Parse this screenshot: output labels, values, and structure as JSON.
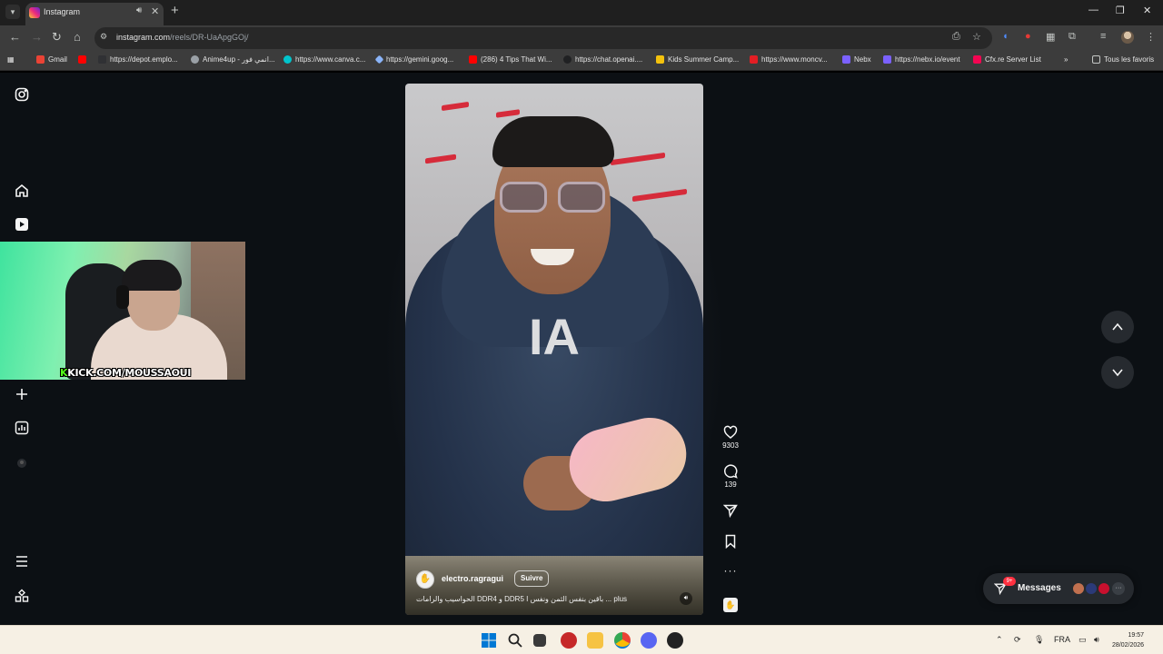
{
  "browser": {
    "tab": {
      "title": "Instagram"
    },
    "url": {
      "host": "instagram.com",
      "path": "/reels/DR-UaApgGOj/"
    },
    "bookmarks": [
      {
        "label": "Gmail",
        "color": "#ea4335"
      },
      {
        "label": "https://depot.emplo...",
        "color": "#ff0000"
      },
      {
        "label": "Anime4up - انمي فور...",
        "color": "#9aa0a6"
      },
      {
        "label": "https://www.canva.c...",
        "color": "#00c4cc"
      },
      {
        "label": "https://gemini.goog...",
        "color": "#8ab4f8"
      },
      {
        "label": "(286) 4 Tips That Wi...",
        "color": "#ff0000"
      },
      {
        "label": "https://chat.openai....",
        "color": "#202123"
      },
      {
        "label": "Kids Summer Camp...",
        "color": "#f4c20d"
      },
      {
        "label": "https://www.moncv...",
        "color": "#e31e24"
      },
      {
        "label": "Nebx",
        "color": "#7b61ff"
      },
      {
        "label": "https://nebx.io/event",
        "color": "#7b61ff"
      },
      {
        "label": "Cfx.re Server List",
        "color": "#f40552"
      }
    ],
    "bookmarks_overflow": "»",
    "all_bookmarks": "Tous les favoris"
  },
  "webcam": {
    "overlay_prefix": "K",
    "overlay_text": "KICK.COM/MOUSSAOUI"
  },
  "reel": {
    "overlay_text": "IA",
    "username": "electro.ragragui",
    "follow_label": "Suivre",
    "description": "الحواسيب والرامات DDR4 و DDR5 باقين بنفس الثمن ونفس ا ... plus",
    "likes": "9303",
    "comments": "139"
  },
  "messages": {
    "label": "Messages",
    "badge": "9+"
  },
  "taskbar": {
    "language": "FRA",
    "time": "19:57",
    "date": "28/02/2026"
  },
  "colors": {
    "accent_badge": "#ff3040",
    "page_bg": "#0c1014",
    "taskbar_bg": "#f6f0e4"
  }
}
